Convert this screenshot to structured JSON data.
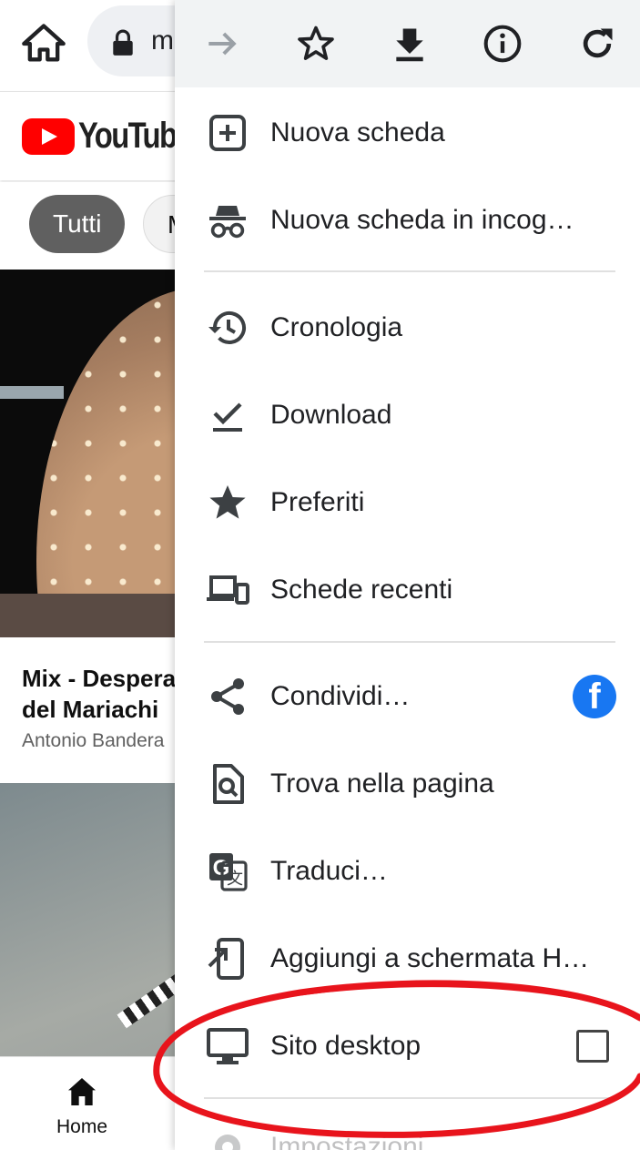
{
  "browser": {
    "url_partial": "m",
    "toolbar_icons": [
      "forward-arrow-icon",
      "bookmark-star-icon",
      "download-icon",
      "page-info-icon",
      "reload-icon"
    ]
  },
  "youtube": {
    "logo_text": "YouTube",
    "chips": [
      "Tutti",
      "M"
    ],
    "video": {
      "title": "Mix - Despera\ndel Mariachi",
      "channel": "Antonio Bandera"
    },
    "bottom_nav": {
      "home_label": "Home"
    }
  },
  "menu": {
    "items": [
      {
        "label": "Nuova scheda",
        "icon": "new-tab-icon"
      },
      {
        "label": "Nuova scheda in incog…",
        "icon": "incognito-icon"
      },
      {
        "label": "Cronologia",
        "icon": "history-icon"
      },
      {
        "label": "Download",
        "icon": "downloads-icon"
      },
      {
        "label": "Preferiti",
        "icon": "bookmarks-star-icon"
      },
      {
        "label": "Schede recenti",
        "icon": "recent-tabs-icon"
      },
      {
        "label": "Condividi…",
        "icon": "share-icon",
        "extra": "facebook-icon"
      },
      {
        "label": "Trova nella pagina",
        "icon": "find-in-page-icon"
      },
      {
        "label": "Traduci…",
        "icon": "translate-icon"
      },
      {
        "label": "Aggiungi a schermata H…",
        "icon": "add-to-home-icon"
      },
      {
        "label": "Sito desktop",
        "icon": "desktop-site-icon",
        "checked": false
      },
      {
        "label": "Impostazioni",
        "icon": "settings-icon"
      }
    ],
    "facebook_glyph": "f"
  },
  "annotation": {
    "color": "#e8141c",
    "highlighted_item": "Sito desktop"
  }
}
